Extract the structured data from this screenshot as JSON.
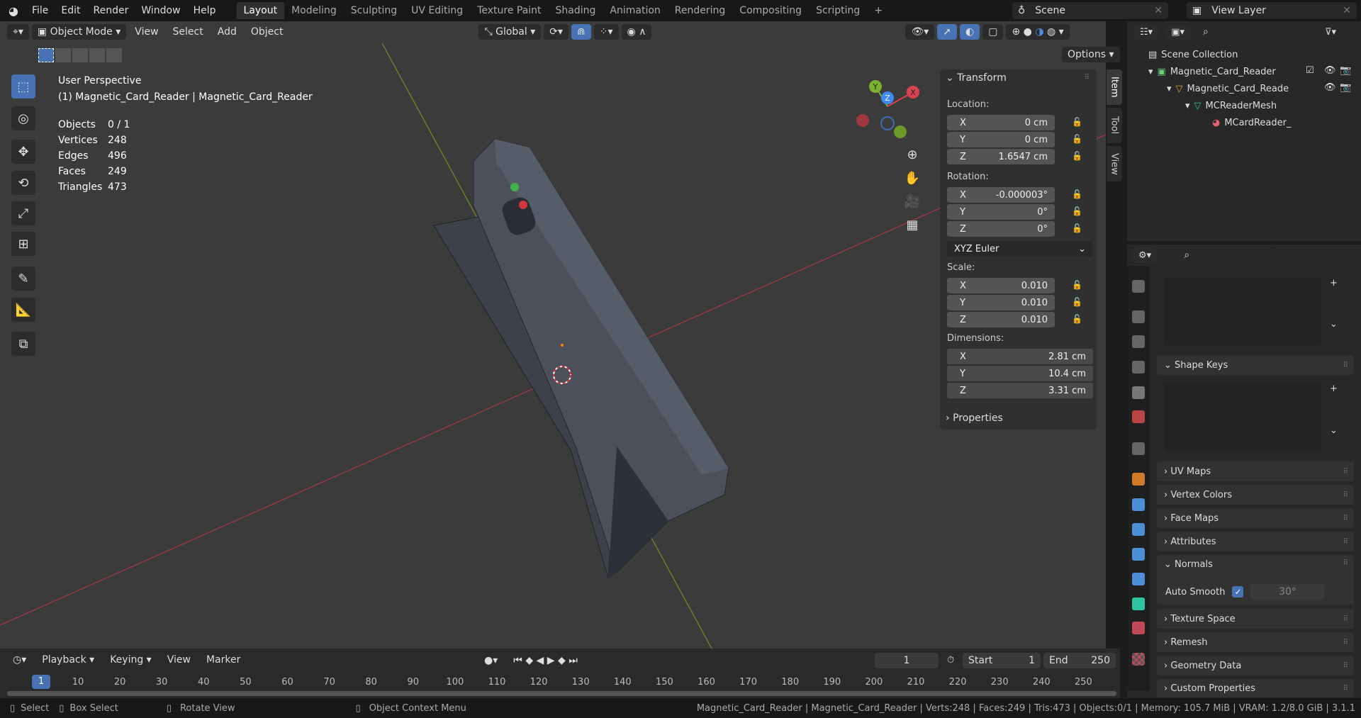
{
  "topbar": {
    "menus": [
      "File",
      "Edit",
      "Render",
      "Window",
      "Help"
    ],
    "workspaces": [
      "Layout",
      "Modeling",
      "Sculpting",
      "UV Editing",
      "Texture Paint",
      "Shading",
      "Animation",
      "Rendering",
      "Compositing",
      "Scripting"
    ],
    "active_workspace": "Layout",
    "add_tab": "+",
    "scene": "Scene",
    "view_layer": "View Layer"
  },
  "viewport": {
    "mode": "Object Mode",
    "menus": [
      "View",
      "Select",
      "Add",
      "Object"
    ],
    "orientation": "Global",
    "options": "Options",
    "overlay_title": "User Perspective",
    "overlay_subtitle": "(1) Magnetic_Card_Reader | Magnetic_Card_Reader",
    "stats": [
      {
        "label": "Objects",
        "value": "0 / 1"
      },
      {
        "label": "Vertices",
        "value": "248"
      },
      {
        "label": "Edges",
        "value": "496"
      },
      {
        "label": "Faces",
        "value": "249"
      },
      {
        "label": "Triangles",
        "value": "473"
      }
    ],
    "gizmo": {
      "x": "X",
      "y": "Y",
      "z": "Z"
    }
  },
  "npanel": {
    "tabs": [
      "Item",
      "Tool",
      "View"
    ],
    "transform": "Transform",
    "location_label": "Location:",
    "location": [
      {
        "axis": "X",
        "value": "0 cm"
      },
      {
        "axis": "Y",
        "value": "0 cm"
      },
      {
        "axis": "Z",
        "value": "1.6547 cm"
      }
    ],
    "rotation_label": "Rotation:",
    "rotation": [
      {
        "axis": "X",
        "value": "-0.000003°"
      },
      {
        "axis": "Y",
        "value": "0°"
      },
      {
        "axis": "Z",
        "value": "0°"
      }
    ],
    "rotation_mode": "XYZ Euler",
    "scale_label": "Scale:",
    "scale": [
      {
        "axis": "X",
        "value": "0.010"
      },
      {
        "axis": "Y",
        "value": "0.010"
      },
      {
        "axis": "Z",
        "value": "0.010"
      }
    ],
    "dimensions_label": "Dimensions:",
    "dimensions": [
      {
        "axis": "X",
        "value": "2.81 cm"
      },
      {
        "axis": "Y",
        "value": "10.4 cm"
      },
      {
        "axis": "Z",
        "value": "3.31 cm"
      }
    ],
    "properties": "Properties"
  },
  "outliner": {
    "root": "Scene Collection",
    "items": [
      "Magnetic_Card_Reader",
      "Magnetic_Card_Reade",
      "MCReaderMesh",
      "MCardReader_"
    ]
  },
  "properties": {
    "sections": [
      "Shape Keys",
      "UV Maps",
      "Vertex Colors",
      "Face Maps",
      "Attributes",
      "Normals",
      "Texture Space",
      "Remesh",
      "Geometry Data",
      "Custom Properties"
    ],
    "auto_smooth_label": "Auto Smooth",
    "auto_smooth": true,
    "angle": "30°"
  },
  "timeline": {
    "menus": [
      "Playback",
      "Keying",
      "View",
      "Marker"
    ],
    "current_frame": "1",
    "start_label": "Start",
    "start": "1",
    "end_label": "End",
    "end": "250",
    "ticks": [
      "10",
      "20",
      "30",
      "40",
      "50",
      "60",
      "70",
      "80",
      "90",
      "100",
      "110",
      "120",
      "130",
      "140",
      "150",
      "160",
      "170",
      "180",
      "190",
      "200",
      "210",
      "220",
      "230",
      "240",
      "250"
    ],
    "frame_marker": "1"
  },
  "status": {
    "select": "Select",
    "box_select": "Box Select",
    "rotate_view": "Rotate View",
    "context_menu": "Object Context Menu",
    "info": "Magnetic_Card_Reader | Magnetic_Card_Reader | Verts:248 | Faces:249 | Tris:473 | Objects:0/1 | Memory: 105.7 MiB | VRAM: 1.2/8.0 GiB | 3.1.1"
  },
  "colors": {
    "accent": "#4772b3",
    "x_axis": "#d9424f",
    "y_axis": "#7bb12f",
    "z_axis": "#3d8af3"
  }
}
